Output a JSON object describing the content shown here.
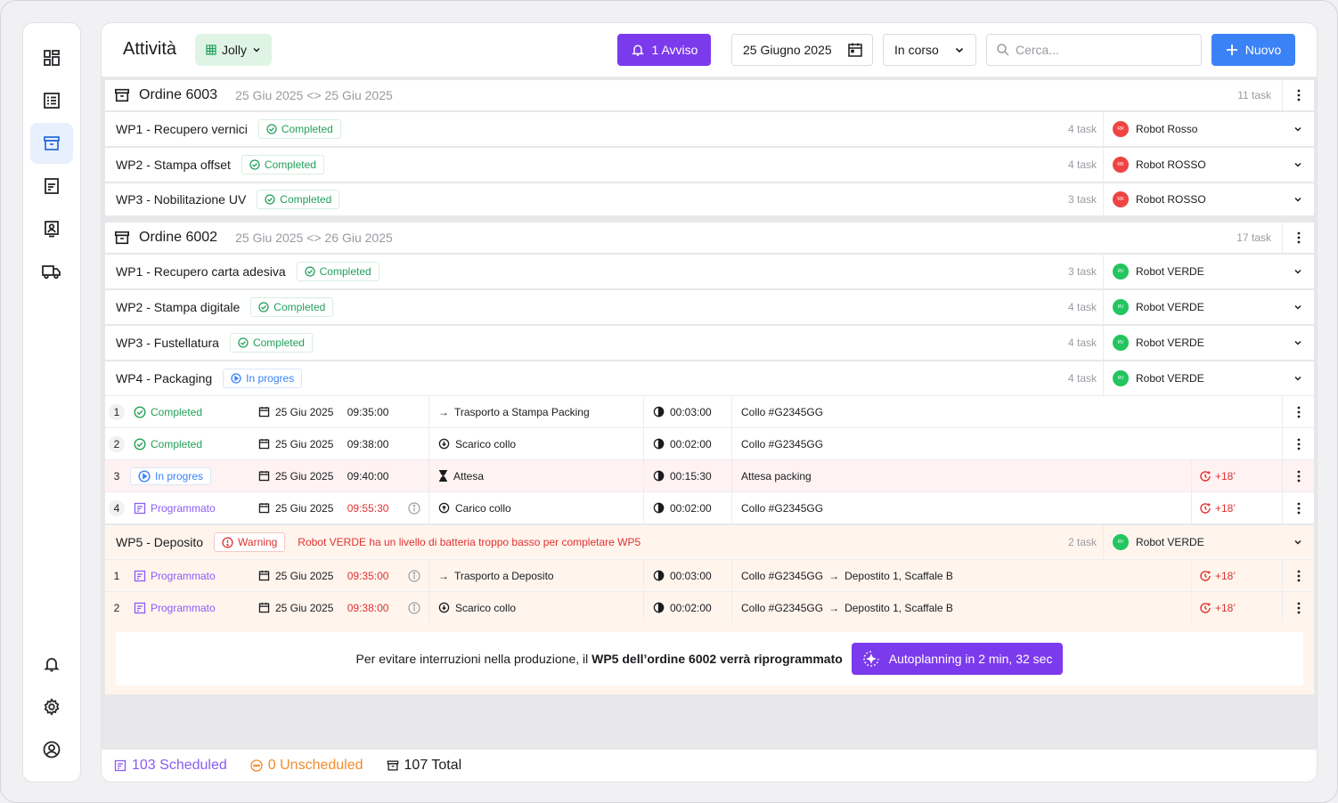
{
  "header": {
    "title": "Attività",
    "view_label": "Jolly",
    "alert_label": "1 Avviso",
    "date_label": "25 Giugno 2025",
    "status_filter": "In corso",
    "search_placeholder": "Cerca...",
    "new_label": "Nuovo"
  },
  "sidebar": {
    "items": [
      {
        "icon": "dashboard-icon"
      },
      {
        "icon": "list-icon"
      },
      {
        "icon": "archive-icon",
        "active": true
      },
      {
        "icon": "document-icon"
      },
      {
        "icon": "contact-card-icon"
      },
      {
        "icon": "truck-icon"
      }
    ],
    "bottom": [
      {
        "icon": "bell-icon"
      },
      {
        "icon": "gear-icon"
      },
      {
        "icon": "user-icon"
      }
    ]
  },
  "orders": [
    {
      "title": "Ordine 6003",
      "start": "25 Giu 2025",
      "end": "25 Giu 2025",
      "task_count": "11 task",
      "wps": [
        {
          "name": "WP1 - Recupero vernici",
          "status": "Completed",
          "tasks": "4 task",
          "robot": "Robot Rosso",
          "robot_initials": "RR"
        },
        {
          "name": "WP2 - Stampa offset",
          "status": "Completed",
          "tasks": "4 task",
          "robot": "Robot ROSSO",
          "robot_initials": "RR"
        },
        {
          "name": "WP3 - Nobilitazione UV",
          "status": "Completed",
          "tasks": "3 task",
          "robot": "Robot ROSSO",
          "robot_initials": "RR"
        }
      ]
    },
    {
      "title": "Ordine 6002",
      "start": "25 Giu 2025",
      "end": "26 Giu 2025",
      "task_count": "17 task",
      "wps": [
        {
          "name": "WP1 - Recupero carta adesiva",
          "status": "Completed",
          "tasks": "3 task",
          "robot": "Robot VERDE",
          "robot_initials": "RV"
        },
        {
          "name": "WP2 - Stampa digitale",
          "status": "Completed",
          "tasks": "4 task",
          "robot": "Robot VERDE",
          "robot_initials": "RV"
        },
        {
          "name": "WP3 - Fustellatura",
          "status": "Completed",
          "tasks": "4 task",
          "robot": "Robot VERDE",
          "robot_initials": "RV"
        },
        {
          "name": "WP4 - Packaging",
          "status": "In progres",
          "tasks": "4 task",
          "robot": "Robot VERDE",
          "robot_initials": "RV"
        }
      ]
    }
  ],
  "wp4_tasks": [
    {
      "n": "1",
      "status": "Completed",
      "date": "25 Giu 2025",
      "time": "09:35:00",
      "activity": "Trasporto a Stampa Packing",
      "duration": "00:03:00",
      "note": "Collo #G2345GG",
      "delay": ""
    },
    {
      "n": "2",
      "status": "Completed",
      "date": "25 Giu 2025",
      "time": "09:38:00",
      "activity": "Scarico collo",
      "duration": "00:02:00",
      "note": "Collo #G2345GG",
      "delay": ""
    },
    {
      "n": "3",
      "status": "In progres",
      "date": "25 Giu 2025",
      "time": "09:40:00",
      "activity": "Attesa",
      "duration": "00:15:30",
      "note": "Attesa packing",
      "delay": "+18’"
    },
    {
      "n": "4",
      "status": "Programmato",
      "date": "25 Giu 2025",
      "time": "09:55:30",
      "activity": "Carico collo",
      "duration": "00:02:00",
      "note": "Collo #G2345GG",
      "delay": "+18’"
    }
  ],
  "wp5": {
    "name": "WP5 - Deposito",
    "status": "Warning",
    "warning_msg": "Robot VERDE ha un livello di batteria troppo basso per completare WP5",
    "tasks": "2 task",
    "robot": "Robot VERDE",
    "robot_initials": "RV",
    "rows": [
      {
        "n": "1",
        "status": "Programmato",
        "date": "25 Giu 2025",
        "time": "09:35:00",
        "activity": "Trasporto a Deposito",
        "duration": "00:03:00",
        "note_from": "Collo #G2345GG",
        "note_to": "Depostito 1, Scaffale B",
        "delay": "+18’"
      },
      {
        "n": "2",
        "status": "Programmato",
        "date": "25 Giu 2025",
        "time": "09:38:00",
        "activity": "Scarico collo",
        "duration": "00:02:00",
        "note_from": "Collo #G2345GG",
        "note_to": "Depostito 1, Scaffale B",
        "delay": "+18’"
      }
    ]
  },
  "banner": {
    "text_prefix": "Per evitare interruzioni nella produzione, il",
    "text_bold": "WP5 dell’ordine 6002 verrà riprogrammato",
    "button": "Autoplanning in 2 min, 32 sec"
  },
  "footer": {
    "scheduled": "103 Scheduled",
    "unscheduled": "0 Unscheduled",
    "total": "107 Total"
  },
  "colors": {
    "accent_purple": "#7c3aed",
    "accent_blue": "#3b82f6",
    "success": "#22a05a",
    "danger": "#e03131",
    "warning_bg": "#fff5ed"
  }
}
